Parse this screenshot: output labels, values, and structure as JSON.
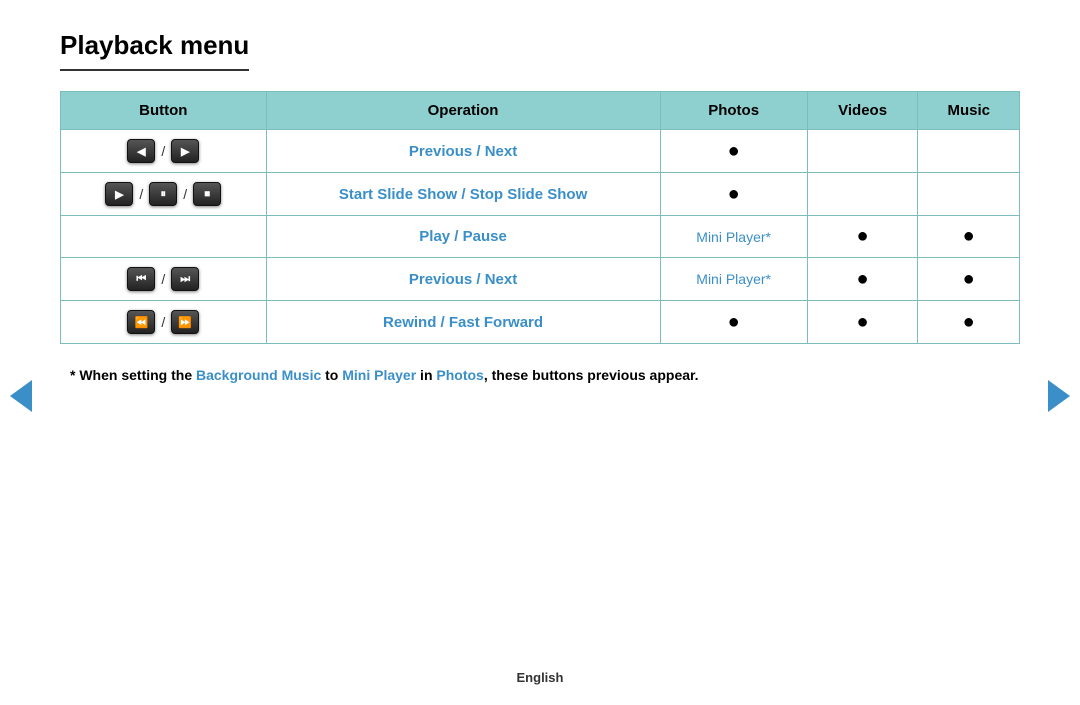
{
  "page": {
    "title": "Playback menu",
    "footer_lang": "English"
  },
  "table": {
    "headers": [
      "Button",
      "Operation",
      "Photos",
      "Videos",
      "Music"
    ],
    "rows": [
      {
        "buttons": [
          {
            "icon": "◀",
            "label": "prev-icon"
          },
          {
            "slash": "/"
          },
          {
            "icon": "▶",
            "label": "next-icon"
          }
        ],
        "operation": "Previous / Next",
        "photos": "bullet",
        "videos": "",
        "music": ""
      },
      {
        "buttons": [
          {
            "icon": "▶",
            "label": "play-icon"
          },
          {
            "slash": "/"
          },
          {
            "icon": "⏸",
            "label": "pause-icon"
          },
          {
            "slash": "/"
          },
          {
            "icon": "⏹",
            "label": "stop-icon"
          }
        ],
        "operation": "Start Slide Show / Stop Slide Show",
        "photos": "bullet",
        "videos": "",
        "music": ""
      },
      {
        "buttons": [],
        "operation": "Play / Pause",
        "photos": "mini",
        "videos": "bullet",
        "music": "bullet"
      },
      {
        "buttons": [
          {
            "icon": "⏮",
            "label": "skip-prev-icon"
          },
          {
            "slash": "/"
          },
          {
            "icon": "⏭",
            "label": "skip-next-icon"
          }
        ],
        "operation": "Previous / Next",
        "photos": "mini",
        "videos": "bullet",
        "music": "bullet"
      },
      {
        "buttons": [
          {
            "icon": "⏪",
            "label": "rewind-icon"
          },
          {
            "slash": "/"
          },
          {
            "icon": "⏩",
            "label": "ff-icon"
          }
        ],
        "operation": "Rewind / Fast Forward",
        "photos": "bullet",
        "videos": "bullet",
        "music": "bullet"
      }
    ]
  },
  "footnote": {
    "text_before": "* When setting the ",
    "link1": "Background Music",
    "text_mid1": " to ",
    "link2": "Mini Player",
    "text_mid2": " in ",
    "link3": "Photos",
    "text_after": ", these buttons previous appear."
  },
  "nav": {
    "left_label": "Previous page",
    "right_label": "Next page"
  }
}
